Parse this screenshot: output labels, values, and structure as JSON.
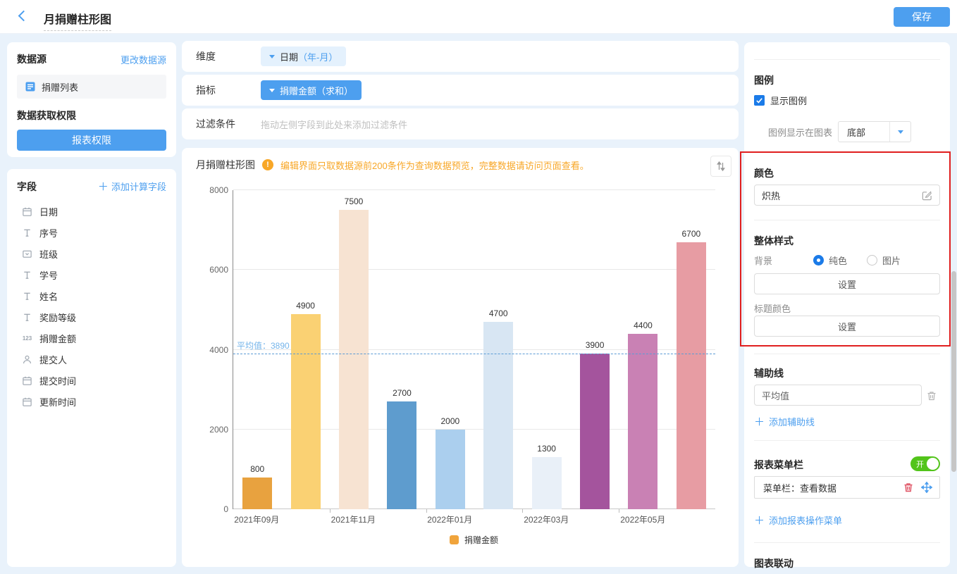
{
  "topbar": {
    "title": "月捐赠柱形图",
    "save_label": "保存"
  },
  "left": {
    "datasource_title": "数据源",
    "change_datasource_link": "更改数据源",
    "datasource_item": "捐赠列表",
    "permission_title": "数据获取权限",
    "permission_button": "报表权限",
    "fields_title": "字段",
    "add_calc_field_link": "添加计算字段",
    "fields": [
      {
        "icon": "calendar",
        "label": "日期"
      },
      {
        "icon": "text",
        "label": "序号"
      },
      {
        "icon": "select",
        "label": "班级"
      },
      {
        "icon": "text",
        "label": "学号"
      },
      {
        "icon": "text",
        "label": "姓名"
      },
      {
        "icon": "text",
        "label": "奖励等级"
      },
      {
        "icon": "number",
        "label": "捐赠金额"
      },
      {
        "icon": "person",
        "label": "提交人"
      },
      {
        "icon": "calendar",
        "label": "提交时间"
      },
      {
        "icon": "calendar",
        "label": "更新时间"
      }
    ]
  },
  "config": {
    "dimension_label": "维度",
    "dimension_value": {
      "name": "日期",
      "suffix": "（年-月）"
    },
    "metric_label": "指标",
    "metric_value": "捐赠金额（求和）",
    "filter_label": "过滤条件",
    "filter_placeholder": "拖动左侧字段到此处来添加过滤条件"
  },
  "chart_header": {
    "title": "月捐赠柱形图",
    "warning_icon": "!",
    "warning_text": "编辑界面只取数据源前200条作为查询数据预览，完整数据请访问页面查看。"
  },
  "chart_data": {
    "type": "bar",
    "title": "月捐赠柱形图",
    "categories": [
      "2021年09月",
      "",
      "2021年11月",
      "",
      "2022年01月",
      "",
      "2022年03月",
      "",
      "2022年05月",
      ""
    ],
    "values": [
      800,
      4900,
      7500,
      2700,
      2000,
      4700,
      1300,
      3900,
      4400,
      6700
    ],
    "bar_colors": [
      "#E8A23F",
      "#FAD173",
      "#F7E3D2",
      "#5E9CCE",
      "#ABCFEE",
      "#D8E6F3",
      "#E9F0F8",
      "#A4549D",
      "#C981B4",
      "#E79CA3"
    ],
    "series_name": "捐赠金额",
    "ylim": [
      0,
      8000
    ],
    "yticks": [
      0,
      2000,
      4000,
      6000,
      8000
    ],
    "grid": true,
    "reference_line": {
      "name": "平均值",
      "value": 3890,
      "display": "平均值：3890"
    },
    "legend": {
      "position": "bottom",
      "items": [
        "捐赠金额"
      ],
      "swatch_color": "#F0A43C"
    }
  },
  "right": {
    "legend_section": {
      "title": "图例",
      "show_label": "显示图例",
      "checked": true,
      "position_label": "图例显示在图表",
      "position_value": "底部"
    },
    "color_section": {
      "title": "颜色",
      "value": "炽热"
    },
    "style_section": {
      "title": "整体样式",
      "background_label": "背景",
      "bg_options": [
        {
          "label": "纯色",
          "selected": true
        },
        {
          "label": "图片",
          "selected": false
        }
      ],
      "bg_set_button": "设置",
      "title_color_label": "标题颜色",
      "title_color_set_button": "设置"
    },
    "guide_section": {
      "title": "辅助线",
      "line_name": "平均值",
      "add_link": "添加辅助线"
    },
    "menu_section": {
      "title": "报表菜单栏",
      "toggle_label": "开",
      "toggle_on": true,
      "item": "菜单栏：查看数据",
      "add_link": "添加报表操作菜单"
    },
    "linkage_section": {
      "title": "图表联动"
    }
  },
  "colors": {
    "accent_blue": "#4D9FEF",
    "strong_blue": "#1B7BE8",
    "warning_orange": "#F8A727",
    "toggle_green": "#52C41A",
    "danger_red": "#E05667",
    "highlight_red": "#E01F1F",
    "avg_line_blue": "#5B9BD5"
  }
}
